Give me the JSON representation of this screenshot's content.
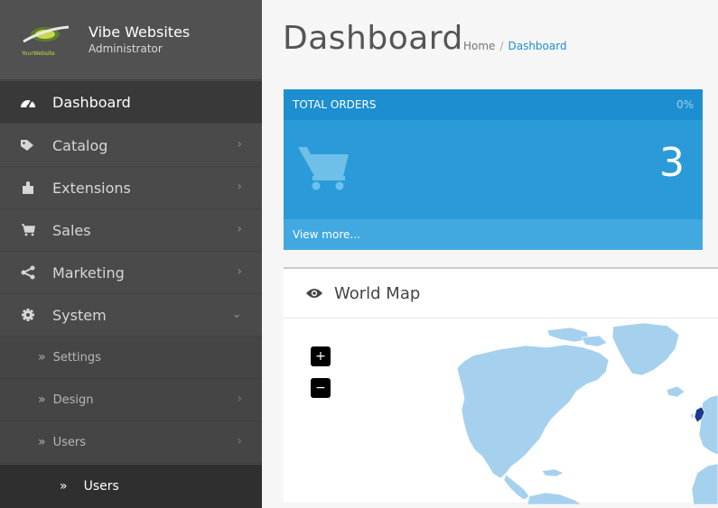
{
  "brand": {
    "name": "Vibe Websites",
    "role": "Administrator",
    "logo_text": "YourWebsite"
  },
  "sidebar": {
    "items": [
      {
        "label": "Dashboard",
        "icon": "dashboard-icon"
      },
      {
        "label": "Catalog",
        "icon": "tags-icon",
        "chevron": "›"
      },
      {
        "label": "Extensions",
        "icon": "puzzle-icon",
        "chevron": "›"
      },
      {
        "label": "Sales",
        "icon": "cart-icon",
        "chevron": "›"
      },
      {
        "label": "Marketing",
        "icon": "share-icon",
        "chevron": "›"
      },
      {
        "label": "System",
        "icon": "cog-icon",
        "chevron": "⌄"
      }
    ],
    "sub_items": [
      {
        "label": "Settings",
        "marker": "»"
      },
      {
        "label": "Design",
        "marker": "»",
        "chevron": "›"
      },
      {
        "label": "Users",
        "marker": "»",
        "chevron": "›"
      }
    ],
    "sub_sub_item": {
      "label": "Users",
      "marker": "»"
    }
  },
  "header": {
    "title": "Dashboard",
    "breadcrumb": {
      "home": "Home",
      "separator": "/",
      "current": "Dashboard"
    }
  },
  "tile": {
    "heading": "TOTAL ORDERS",
    "percent": "0%",
    "value": "3",
    "footer": "View more...",
    "icon": "shopping-cart-icon"
  },
  "map_panel": {
    "title": "World Map",
    "icon": "eye-icon",
    "zoom_in": "+",
    "zoom_out": "−"
  },
  "colors": {
    "accent": "#1e90d2",
    "tile": "#2a9bd8",
    "sidebar": "#4a4a4a",
    "map_land": "#a6d1ee",
    "map_highlight": "#1b3a8c"
  }
}
